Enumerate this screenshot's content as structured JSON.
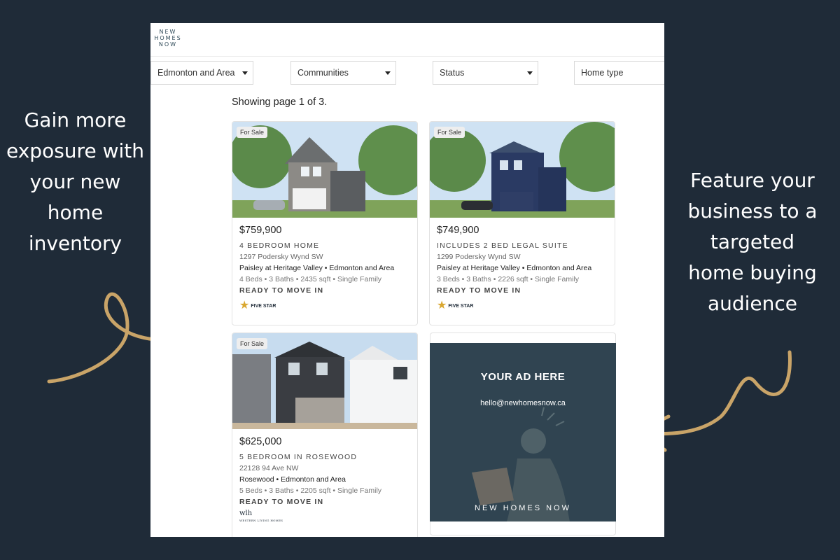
{
  "left_caption": "Gain more\nexposure with\nyour new\nhome\ninventory",
  "right_caption": "Feature your\nbusiness to a\ntargeted\nhome buying\naudience",
  "logo": {
    "line1": "NEW",
    "line2": "HOMES",
    "line3": "NOW"
  },
  "filters": [
    {
      "label": "Edmonton and Area"
    },
    {
      "label": "Communities"
    },
    {
      "label": "Status"
    },
    {
      "label": "Home type"
    }
  ],
  "showing_text": "Showing page 1 of 3.",
  "listings": [
    {
      "badge": "For Sale",
      "price": "$759,900",
      "headline": "4 BEDROOM HOME",
      "address": "1297 Podersky Wynd SW",
      "community": "Paisley at Heritage Valley • Edmonton and Area",
      "specs": "4 Beds • 3 Baths • 2435 sqft • Single Family",
      "status": "READY TO MOVE IN",
      "builder": "FIVE STAR"
    },
    {
      "badge": "For Sale",
      "price": "$749,900",
      "headline": "INCLUDES 2 BED LEGAL SUITE",
      "address": "1299 Podersky Wynd SW",
      "community": "Paisley at Heritage Valley • Edmonton and Area",
      "specs": "3 Beds • 3 Baths • 2226 sqft • Single Family",
      "status": "READY TO MOVE IN",
      "builder": "FIVE STAR"
    },
    {
      "badge": "For Sale",
      "price": "$625,000",
      "headline": "5 BEDROOM IN ROSEWOOD",
      "address": "22128 94 Ave NW",
      "community": "Rosewood • Edmonton and Area",
      "specs": "5 Beds • 3 Baths • 2205 sqft • Single Family",
      "status": "READY TO MOVE IN",
      "builder": "wlh",
      "builder_sub": "WESTERN LIVING HOMES"
    }
  ],
  "ad": {
    "title": "YOUR AD HERE",
    "email": "hello@newhomesnow.ca",
    "brand": "NEW HOMES NOW"
  },
  "colors": {
    "background": "#1f2b38",
    "accent": "#c9a468",
    "ad_bg": "#304451"
  }
}
